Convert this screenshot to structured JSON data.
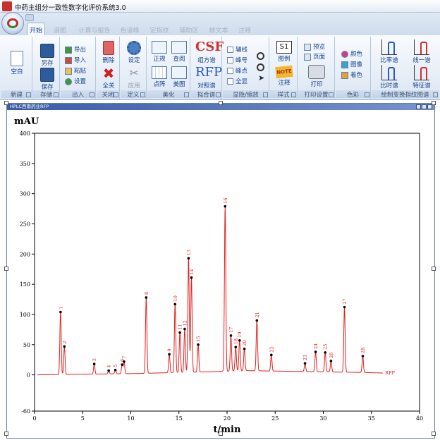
{
  "window": {
    "title": "中药主组分一致性数字化评价系统3.0"
  },
  "tabs": [
    {
      "label": "开始",
      "active": true
    },
    {
      "label": "谱图",
      "active": false
    },
    {
      "label": "计算与报告",
      "active": false
    },
    {
      "label": "色谱峰",
      "active": false
    },
    {
      "label": "定指纹",
      "active": false
    },
    {
      "label": "辅助区",
      "active": false
    },
    {
      "label": "帧文本",
      "active": false
    },
    {
      "label": "注释",
      "active": false
    }
  ],
  "ribbon": {
    "groups": {
      "new": "新建",
      "store": "存储",
      "io": "出入",
      "close": "关闭",
      "define": "定义",
      "beautify": "美化",
      "fit": "拟合谱",
      "hide": "显隐/缩放",
      "style": "样式",
      "print": "打印设置",
      "color": "色彩",
      "draw": "绘制变换指纹图谱"
    },
    "buttons": {
      "blank": "空白",
      "save_as": "另存",
      "save": "保存",
      "export": "导出",
      "import": "导入",
      "paste": "粘贴",
      "settings_io": "设置",
      "delete": "删除",
      "close_all": "全关",
      "define_set": "设定",
      "apply": "应用",
      "normalize": "正规",
      "review": "查阅",
      "dot_matrix": "点阵",
      "beautify_img": "美图",
      "csf_label": "组方谱",
      "rfp_label": "对照谱",
      "assist_line": "辅线",
      "peak_no": "峰号",
      "peak_point": "峰点",
      "full_view": "全显",
      "legend": "图例",
      "annotate": "注释",
      "s1_text": "S1",
      "note_text": "NOTE",
      "preview": "预览",
      "page": "页面",
      "print": "打印",
      "color": "颜色",
      "pattern": "图像",
      "colorize": "着色",
      "ratio_spec": "比率谱",
      "linear_spec": "线一谱",
      "time_spec": "比时谱",
      "feature_spec": "特征谱",
      "csf_icon": "CSF",
      "rfp_icon": "RFP"
    }
  },
  "chart_window": {
    "title": "HPLC西南药业RFP"
  },
  "chart_data": {
    "type": "line",
    "ylabel": "mAU",
    "xlabel": "t/min",
    "xlim": [
      0,
      40
    ],
    "ylim": [
      -60,
      400
    ],
    "xticks": [
      0,
      5,
      10,
      15,
      20,
      25,
      30,
      35,
      40
    ],
    "yticks": [
      -60,
      0,
      50,
      100,
      150,
      200,
      250,
      300,
      350,
      400
    ],
    "series": [
      {
        "name": "RFP",
        "color": "#e3201c"
      }
    ],
    "baseline": [
      [
        0.3,
        0
      ],
      [
        2.0,
        0.5
      ],
      [
        5,
        1
      ],
      [
        10,
        2
      ],
      [
        15,
        4
      ],
      [
        18,
        5
      ],
      [
        22,
        7
      ],
      [
        26,
        6
      ],
      [
        30,
        5
      ],
      [
        34,
        4
      ],
      [
        36.2,
        3
      ]
    ],
    "peaks": [
      {
        "label": "1",
        "t": 2.7,
        "h": 104
      },
      {
        "label": "2",
        "t": 3.1,
        "h": 47
      },
      {
        "label": "3",
        "t": 6.2,
        "h": 18
      },
      {
        "label": "4",
        "t": 7.7,
        "h": 7
      },
      {
        "label": "5",
        "t": 8.4,
        "h": 8
      },
      {
        "label": "6",
        "t": 9.1,
        "h": 17
      },
      {
        "label": "7",
        "t": 9.3,
        "h": 22
      },
      {
        "label": "8",
        "t": 11.6,
        "h": 128
      },
      {
        "label": "9",
        "t": 14.0,
        "h": 34
      },
      {
        "label": "10",
        "t": 14.6,
        "h": 117
      },
      {
        "label": "11",
        "t": 15.1,
        "h": 70
      },
      {
        "label": "12",
        "t": 15.6,
        "h": 76
      },
      {
        "label": "13",
        "t": 16.0,
        "h": 193
      },
      {
        "label": "14",
        "t": 16.3,
        "h": 161
      },
      {
        "label": "15",
        "t": 17.0,
        "h": 50
      },
      {
        "label": "16",
        "t": 19.8,
        "h": 279
      },
      {
        "label": "17",
        "t": 20.4,
        "h": 65
      },
      {
        "label": "18",
        "t": 20.9,
        "h": 46
      },
      {
        "label": "19",
        "t": 21.3,
        "h": 57
      },
      {
        "label": "20",
        "t": 21.8,
        "h": 43
      },
      {
        "label": "21",
        "t": 23.1,
        "h": 90
      },
      {
        "label": "22",
        "t": 24.6,
        "h": 33
      },
      {
        "label": "23",
        "t": 28.1,
        "h": 19
      },
      {
        "label": "24",
        "t": 29.2,
        "h": 38
      },
      {
        "label": "25",
        "t": 30.2,
        "h": 37
      },
      {
        "label": "26",
        "t": 30.8,
        "h": 23
      },
      {
        "label": "27",
        "t": 32.2,
        "h": 112
      },
      {
        "label": "28",
        "t": 34.1,
        "h": 31
      }
    ],
    "series_end_label": "RFP"
  }
}
